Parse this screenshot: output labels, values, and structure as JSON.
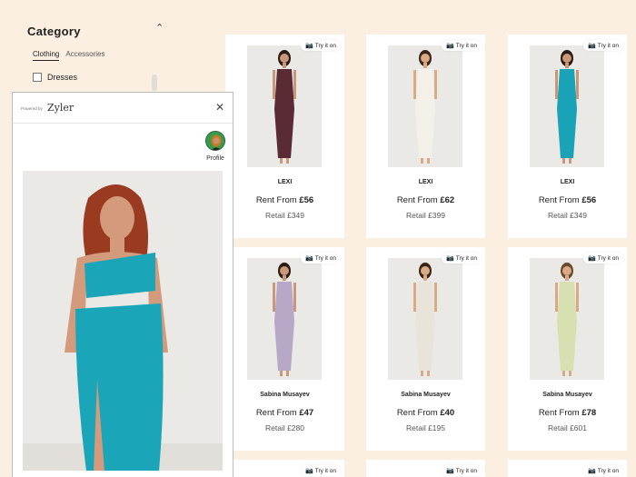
{
  "sidebar": {
    "category_title": "Category",
    "tabs": [
      "Clothing",
      "Accessories"
    ],
    "options": [
      {
        "label": "Dresses",
        "checked": false
      }
    ]
  },
  "products": [
    {
      "brand": "LEXI",
      "rent_prefix": "Rent From ",
      "rent": "£56",
      "retail": "Retail £349",
      "try_on": "Try it on",
      "dress_color": "#5a2a35",
      "skin": "#c99878",
      "hair": "#2a1a14"
    },
    {
      "brand": "LEXI",
      "rent_prefix": "Rent From ",
      "rent": "£62",
      "retail": "Retail £399",
      "try_on": "Try it on",
      "dress_color": "#f3f0ea",
      "skin": "#d8aa86",
      "hair": "#3a2416"
    },
    {
      "brand": "LEXI",
      "rent_prefix": "Rent From ",
      "rent": "£56",
      "retail": "Retail £349",
      "try_on": "Try it on",
      "dress_color": "#1aa3b6",
      "skin": "#c99878",
      "hair": "#2a1a14"
    },
    {
      "brand": "Sabina Musayev",
      "rent_prefix": "Rent From ",
      "rent": "£47",
      "retail": "Retail £280",
      "try_on": "Try it on",
      "dress_color": "#b7a8c8",
      "skin": "#c99878",
      "hair": "#2a1a14"
    },
    {
      "brand": "Sabina Musayev",
      "rent_prefix": "Rent From ",
      "rent": "£40",
      "retail": "Retail £195",
      "try_on": "Try it on",
      "dress_color": "#e9e4da",
      "skin": "#d8aa86",
      "hair": "#3a2416"
    },
    {
      "brand": "Sabina Musayev",
      "rent_prefix": "Rent From ",
      "rent": "£78",
      "retail": "Retail £601",
      "try_on": "Try it on",
      "dress_color": "#d8e0b2",
      "skin": "#d8aa86",
      "hair": "#6a4a2a"
    }
  ],
  "partial_row": {
    "try_on": "Try it on"
  },
  "zyler": {
    "powered_by": "Powered by",
    "logo": "Zyler",
    "profile_label": "Profile",
    "dress_color": "#1aa5b8",
    "hair_color": "#9a3a20",
    "skin_color": "#d49a7c"
  }
}
